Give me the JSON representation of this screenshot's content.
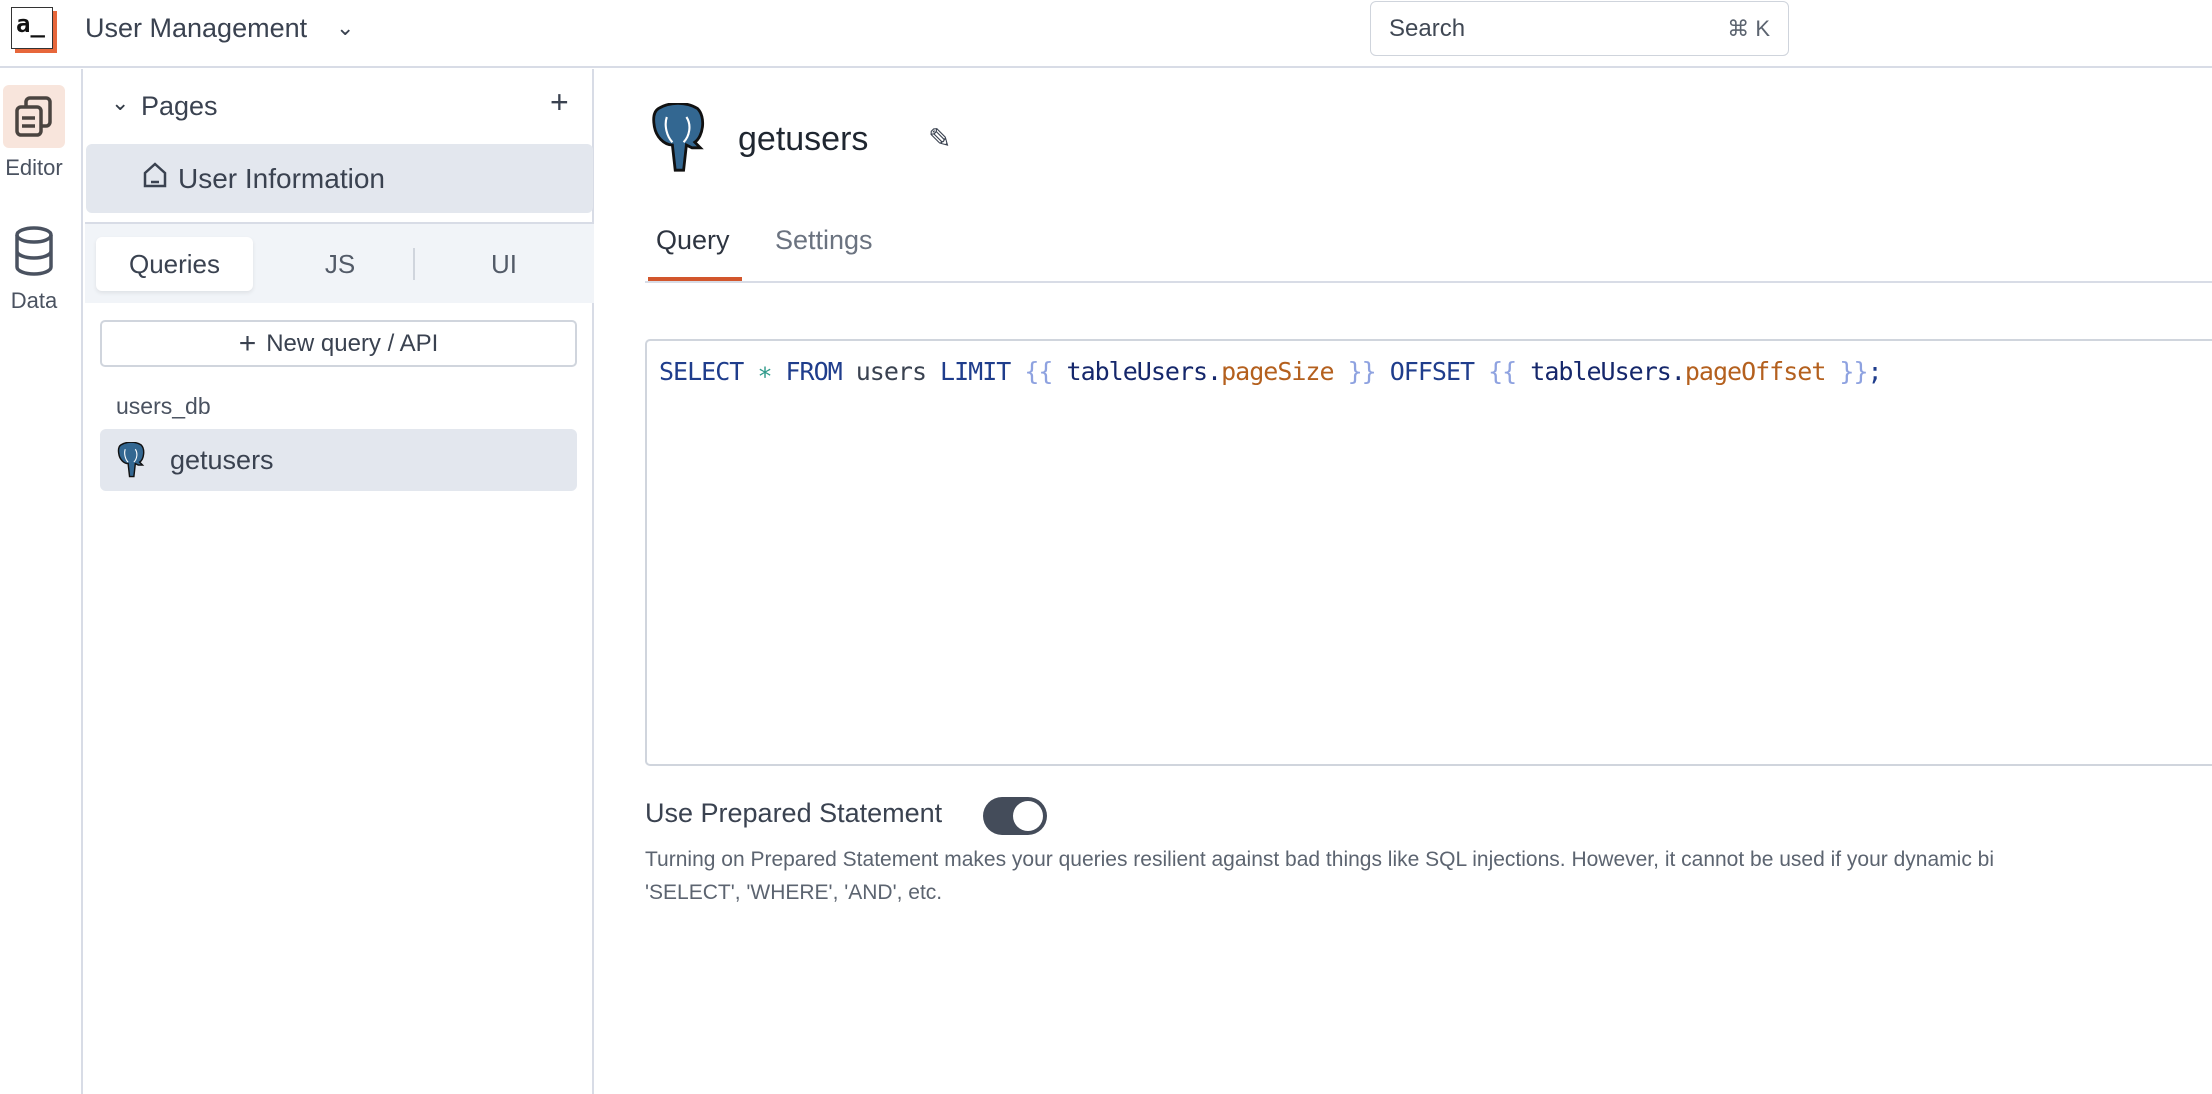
{
  "header": {
    "logo_text": "a_",
    "app_title": "User Management",
    "search_placeholder": "Search",
    "search_shortcut": "⌘ K"
  },
  "rail": {
    "items": [
      {
        "label": "Editor",
        "icon": "editor-icon",
        "active": true
      },
      {
        "label": "Data",
        "icon": "database-icon"
      }
    ]
  },
  "pages": {
    "title": "Pages",
    "items": [
      {
        "label": "User Information",
        "icon": "home-icon",
        "active": true
      }
    ]
  },
  "panel_tabs": [
    {
      "label": "Queries",
      "active": true
    },
    {
      "label": "JS"
    },
    {
      "label": "UI"
    }
  ],
  "new_query_label": "New query / API",
  "datasource": {
    "name": "users_db",
    "queries": [
      {
        "label": "getusers",
        "icon": "postgres-icon",
        "active": true
      }
    ]
  },
  "main": {
    "title": "getusers",
    "tabs": [
      {
        "label": "Query",
        "active": true
      },
      {
        "label": "Settings"
      }
    ],
    "code_tokens": {
      "t0": "SELECT",
      "t1": " ∗ ",
      "t2": "FROM",
      "t3": " users ",
      "t4": "LIMIT",
      "t5": " {{ ",
      "t6": "tableUsers",
      "t7": ".",
      "t8": "pageSize",
      "t9": " }} ",
      "t10": "OFFSET",
      "t11": " {{ ",
      "t12": "tableUsers",
      "t13": ".",
      "t14": "pageOffset",
      "t15": " }}",
      "t16": ";"
    },
    "prepared_label": "Use Prepared Statement",
    "prepared_on": true,
    "prepared_desc": "Turning on Prepared Statement makes your queries resilient against bad things like SQL injections. However, it cannot be used if your dynamic bi",
    "prepared_desc2": "'SELECT', 'WHERE', 'AND', etc."
  },
  "colors": {
    "accent": "#d2562c",
    "toggle": "#444c5a",
    "postgres": "#336791"
  }
}
